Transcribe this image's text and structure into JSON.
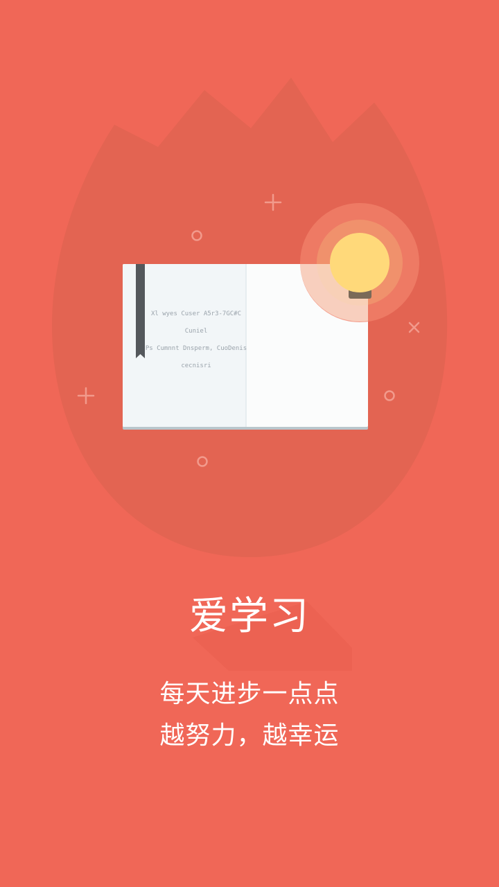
{
  "colors": {
    "background": "#f06757",
    "flame": "#e36452",
    "book_page_left": "#f2f6f8",
    "book_page_right": "#fbfcfc",
    "book_edge": "#b9c6cc",
    "bookmark": "#54585c",
    "bulb": "#ffd97a",
    "bulb_base": "#7a6a58",
    "text": "#ffffff"
  },
  "illustration": {
    "book_lines": [
      "Xl wyes Cuser A5r3-7GC#C",
      "Cuniel",
      "Ps Cumnnt Dnsperm, CuoDenis",
      "cecnisri"
    ],
    "icons": [
      "flame-shape",
      "book-icon",
      "bookmark-icon",
      "lightbulb-icon",
      "plus-icon",
      "circle-icon",
      "cross-icon"
    ]
  },
  "title": "爱学习",
  "subtitle": {
    "line1": "每天进步一点点",
    "line2": "越努力，越幸运"
  }
}
